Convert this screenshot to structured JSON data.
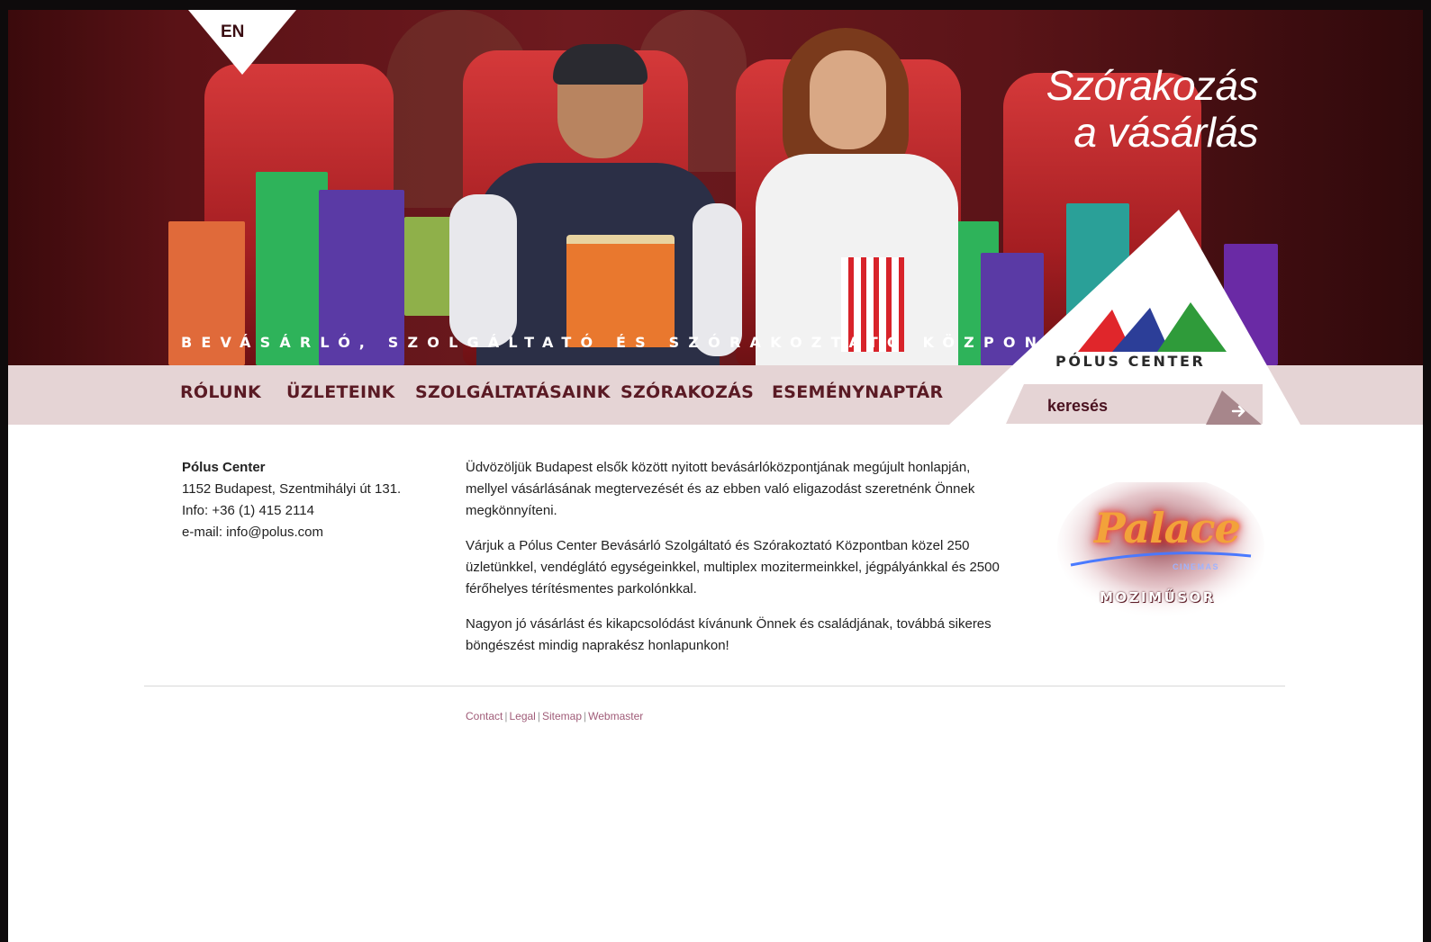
{
  "language_switch": {
    "label": "EN"
  },
  "hero": {
    "slogan_line1": "Szórakozás",
    "slogan_line2": "a vásárlás",
    "tagline": "BEVÁSÁRLÓ, SZOLGÁLTATÓ ÉS SZÓRAKOZTATÓ KÖZPONT"
  },
  "nav": {
    "items": [
      {
        "label": "RÓLUNK"
      },
      {
        "label": "ÜZLETEINK"
      },
      {
        "label": "SZOLGÁLTATÁSAINK"
      },
      {
        "label": "SZÓRAKOZÁS"
      },
      {
        "label": "ESEMÉNYNAPTÁR"
      }
    ]
  },
  "logo": {
    "text": "PÓLUS CENTER",
    "colors": [
      "#e0262b",
      "#2c3e98",
      "#2f9b3a"
    ]
  },
  "search": {
    "placeholder": "keresés",
    "button_icon": "arrow-right-icon"
  },
  "contact": {
    "name": "Pólus Center",
    "address": "1152 Budapest, Szentmihályi út 131.",
    "info": "Info: +36 (1) 415 2114",
    "email": "e-mail: info@polus.com"
  },
  "intro": {
    "paragraphs": [
      "Üdvözöljük Budapest elsők között nyitott bevásárlóközpontjának megújult honlapján, mellyel vásárlásának megtervezését és az ebben való eligazodást szeretnénk Önnek megkönnyíteni.",
      "Várjuk a Pólus Center Bevásárló Szolgáltató és Szórakoztató Központban közel 250 üzletünkkel, vendéglátó egységeinkkel, multiplex mozitermeinkkel, jégpályánkkal és 2500 férőhelyes térítésmentes parkolónkkal.",
      "Nagyon jó vásárlást és kikapcsolódást kívánunk Önnek és családjának, továbbá sikeres böngészést mindig naprakész honlapunkon!"
    ]
  },
  "palace": {
    "logo_word": "Palace",
    "logo_sub": "CINEMAS",
    "link_label": "MOZIMŰSOR"
  },
  "footer": {
    "links": [
      {
        "label": "Contact"
      },
      {
        "label": "Legal"
      },
      {
        "label": "Sitemap"
      },
      {
        "label": "Webmaster"
      }
    ],
    "separator": "|"
  },
  "colors": {
    "nav_bg": "#e5d4d5",
    "nav_text": "#5a1a24",
    "hero_bg": "#6e1a1f",
    "footer_link": "#a05c78"
  }
}
